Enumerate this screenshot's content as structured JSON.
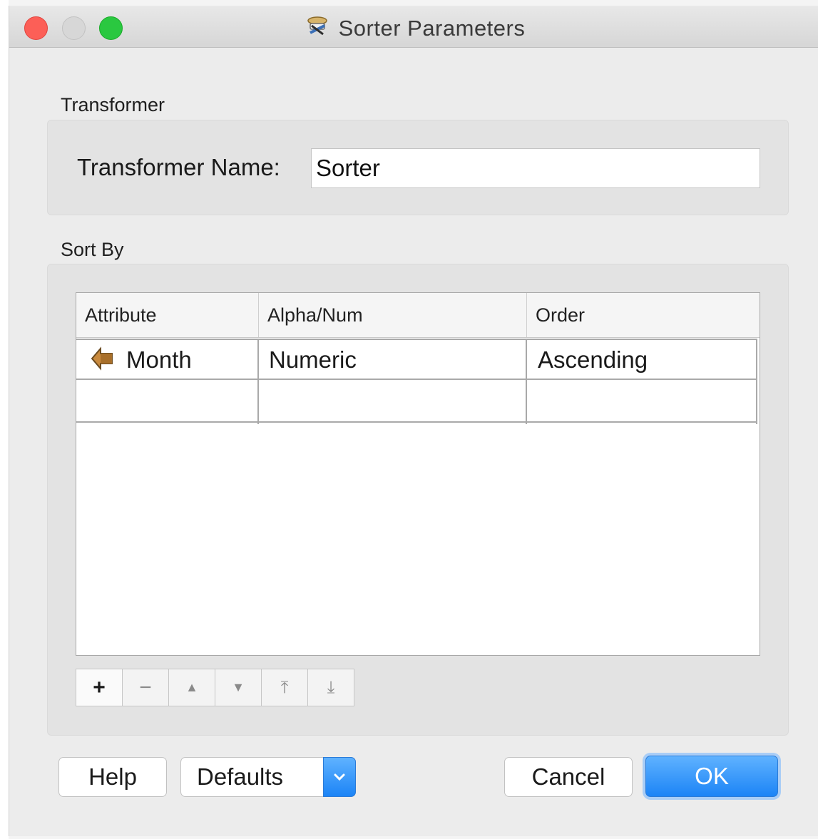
{
  "window": {
    "title": "Sorter Parameters",
    "title_icon": "sorter-transformer-icon"
  },
  "transformer_section": {
    "label": "Transformer",
    "name_label": "Transformer Name:",
    "name_value": "Sorter"
  },
  "sort_section": {
    "label": "Sort By",
    "columns": [
      "Attribute",
      "Alpha/Num",
      "Order"
    ],
    "rows": [
      {
        "attribute": "Month",
        "attribute_icon": "attribute-arrow-icon",
        "alpha_num": "Numeric",
        "order": "Ascending"
      },
      {
        "attribute": "",
        "alpha_num": "",
        "order": ""
      }
    ],
    "toolbar": [
      {
        "name": "add-row-button",
        "icon": "plus-icon",
        "glyph": "+"
      },
      {
        "name": "remove-row-button",
        "icon": "minus-icon",
        "glyph": "−"
      },
      {
        "name": "move-up-button",
        "icon": "triangle-up-icon",
        "glyph": "▲"
      },
      {
        "name": "move-down-button",
        "icon": "triangle-down-icon",
        "glyph": "▼"
      },
      {
        "name": "move-top-button",
        "icon": "move-to-top-icon",
        "glyph": "⤒"
      },
      {
        "name": "move-bottom-button",
        "icon": "move-to-bottom-icon",
        "glyph": "⤓"
      }
    ]
  },
  "buttons": {
    "help": "Help",
    "defaults": "Defaults",
    "cancel": "Cancel",
    "ok": "OK"
  },
  "colors": {
    "accent": "#1c84f6",
    "close": "#fc5f57",
    "maximize": "#2ac840",
    "attribute_icon": "#c98a3e"
  }
}
